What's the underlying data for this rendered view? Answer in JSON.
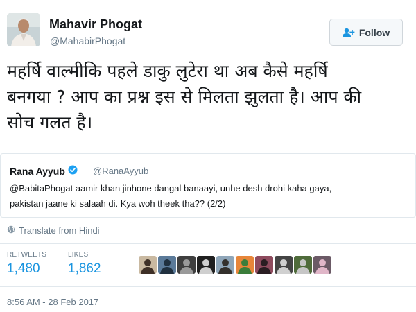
{
  "author": {
    "name": "Mahavir Phogat",
    "handle": "@MahabirPhogat"
  },
  "follow_button": {
    "label": "Follow"
  },
  "tweet": {
    "text_lines": [
      "महर्षि वाल्मीकि पहले डाकु लुटेरा था अब कैसे महर्षि",
      "बनगया ? आप का प्रश्न इस से मिलता झुलता है। आप की",
      "सोच गलत है।"
    ]
  },
  "quoted_tweet": {
    "name": "Rana Ayyub",
    "handle": "@RanaAyyub",
    "verified": true,
    "text_lines": [
      "@BabitaPhogat aamir khan jinhone dangal banaayi, unhe desh drohi kaha gaya,",
      "pakistan jaane ki salaah di. Kya woh theek tha?? (2/2)"
    ]
  },
  "translate": {
    "label": "Translate from Hindi",
    "icon": "globe-icon"
  },
  "stats": {
    "retweets": {
      "label": "RETWEETS",
      "value": "1,480"
    },
    "likes": {
      "label": "LIKES",
      "value": "1,862"
    }
  },
  "likers": [
    {
      "bg": "#c9b9a1",
      "fg": "#3d2f26"
    },
    {
      "bg": "#5b7a99",
      "fg": "#20303f"
    },
    {
      "bg": "#3f3f3f",
      "fg": "#9a9a9a"
    },
    {
      "bg": "#202020",
      "fg": "#cfcfcf"
    },
    {
      "bg": "#8fa6b9",
      "fg": "#33302c"
    },
    {
      "bg": "#e7863a",
      "fg": "#3a7d3a"
    },
    {
      "bg": "#8e4b5e",
      "fg": "#2a1d22"
    },
    {
      "bg": "#444444",
      "fg": "#d0d0d0"
    },
    {
      "bg": "#4f6b3a",
      "fg": "#c6c6c6"
    },
    {
      "bg": "#6b5a66",
      "fg": "#e0b6c8"
    }
  ],
  "timestamp": "8:56 AM - 28 Feb 2017",
  "colors": {
    "link_blue": "#1b95e0",
    "verified_blue": "#1da1f2",
    "muted": "#657786"
  }
}
